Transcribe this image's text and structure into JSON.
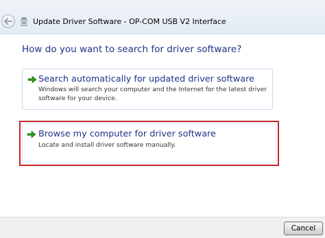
{
  "window": {
    "title": "Update Driver Software - OP-COM USB V2 Interface"
  },
  "main": {
    "heading": "How do you want to search for driver software?",
    "options": [
      {
        "title": "Search automatically for updated driver software",
        "description": "Windows will search your computer and the Internet for the latest driver software for your device."
      },
      {
        "title": "Browse my computer for driver software",
        "description": "Locate and install driver software manually."
      }
    ]
  },
  "footer": {
    "cancel_label": "Cancel"
  },
  "colors": {
    "heading_blue": "#1e3287",
    "highlight_red": "#c4242d",
    "arrow_green": "#2f9a1e"
  },
  "icons": {
    "back": "back-arrow-icon",
    "app": "driver-icon",
    "option_arrow": "green-arrow-icon"
  }
}
